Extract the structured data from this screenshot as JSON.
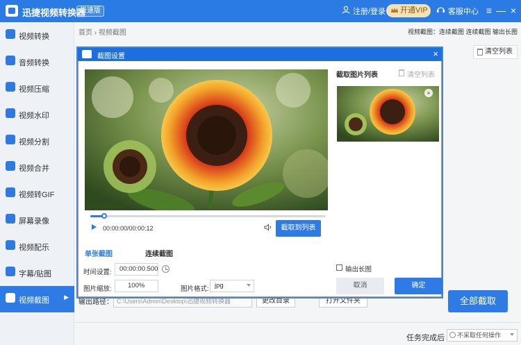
{
  "app": {
    "title": "迅捷视频转换器",
    "edition": "极速版",
    "register_login": "注册/登录",
    "vip": "开通VIP",
    "support": "客服中心",
    "accent": "#2e7be6"
  },
  "sidebar": {
    "items": [
      {
        "label": "视频转换",
        "icon": "video-convert-icon"
      },
      {
        "label": "音频转换",
        "icon": "audio-convert-icon"
      },
      {
        "label": "视频压缩",
        "icon": "video-compress-icon"
      },
      {
        "label": "视频水印",
        "icon": "video-watermark-icon"
      },
      {
        "label": "视频分割",
        "icon": "video-split-icon"
      },
      {
        "label": "视频合并",
        "icon": "video-merge-icon"
      },
      {
        "label": "视频转GIF",
        "icon": "video-gif-icon"
      },
      {
        "label": "屏幕录像",
        "icon": "screen-record-icon"
      },
      {
        "label": "视频配乐",
        "icon": "video-music-icon"
      },
      {
        "label": "字幕/贴图",
        "icon": "subtitle-icon"
      },
      {
        "label": "视频截图",
        "icon": "video-screenshot-icon",
        "active": true
      }
    ]
  },
  "main": {
    "breadcrumb": "首页 › 视频截图",
    "formats": "视频截图：连续截图 连续截图 输出长图",
    "clear_list": "清空列表",
    "output_label": "输出路径：",
    "output_path": "C:\\Users\\Admin\\Desktop\\迅捷视频转换器",
    "change_dir": "更改目录",
    "open_folder": "打开文件夹",
    "capture_all": "全部截取",
    "after_task_label": "任务完成后",
    "after_task_value": "不采取任何操作"
  },
  "dialog": {
    "title": "截图设置",
    "timecode": "00:00:00/00:00:12",
    "add_to_list": "截取到列表",
    "tab_single": "单张截图",
    "tab_continuous": "连续截图",
    "time_label": "时间设置:",
    "time_value": "00:00:00.500",
    "scale_label": "图片缩放:",
    "scale_value": "100%",
    "format_label": "图片格式:",
    "format_value": "jpg",
    "progress_fraction": 0.06,
    "list_title": "截取图片列表",
    "list_clear": "清空列表",
    "output_long": "输出长图",
    "cancel": "取消",
    "confirm": "确定"
  }
}
